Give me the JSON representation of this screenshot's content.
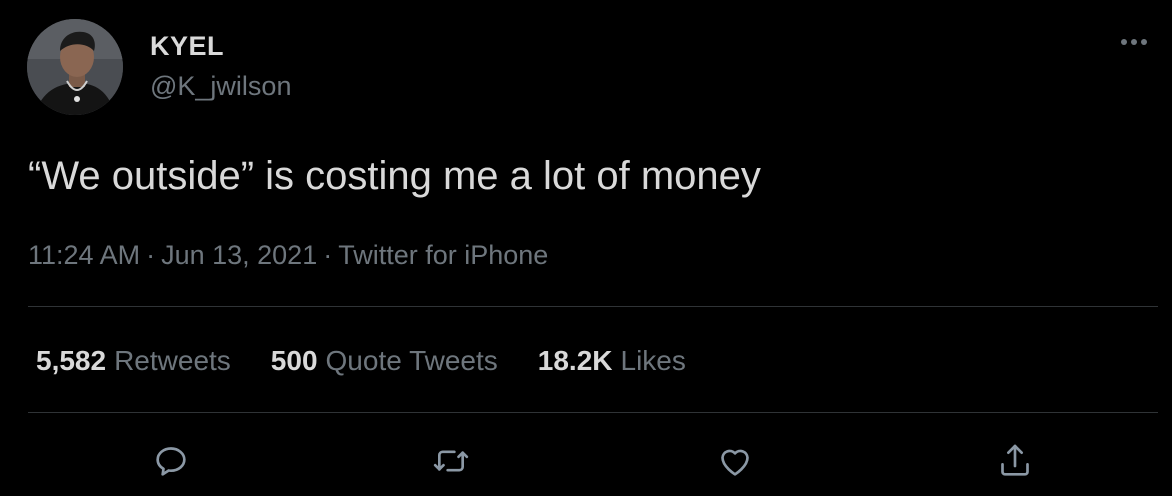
{
  "user": {
    "display_name": "KYEL",
    "handle": "@K_jwilson"
  },
  "tweet": {
    "text": "“We outside” is costing me a lot of money",
    "time": "11:24 AM",
    "date": "Jun 13, 2021",
    "source": "Twitter for iPhone",
    "separator": "·"
  },
  "stats": [
    {
      "value": "5,582",
      "label": "Retweets"
    },
    {
      "value": "500",
      "label": "Quote Tweets"
    },
    {
      "value": "18.2K",
      "label": "Likes"
    }
  ],
  "actions": [
    "reply-icon",
    "retweet-icon",
    "like-icon",
    "share-icon"
  ],
  "colors": {
    "background": "#000000",
    "text": "#d9d9d9",
    "secondary": "#6e767d",
    "divider": "#2f3336"
  }
}
